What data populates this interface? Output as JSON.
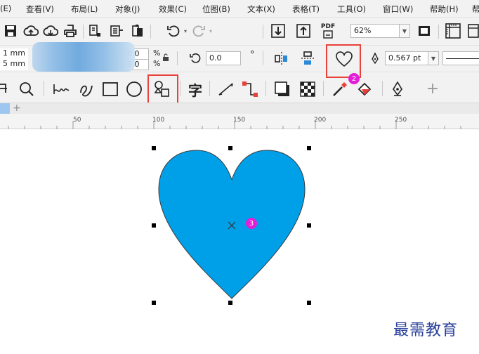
{
  "menu": [
    "(E)",
    "查看(V)",
    "布局(L)",
    "对象(J)",
    "效果(C)",
    "位图(B)",
    "文本(X)",
    "表格(T)",
    "工具(O)",
    "窗口(W)",
    "帮助(H)",
    "帮"
  ],
  "toolbar1": {
    "zoom_value": "62%",
    "pdf_label": "PDF"
  },
  "toolbar2": {
    "width_value": "1 mm",
    "height_value": "5 mm",
    "scale_x": "0.0",
    "scale_y": "0.0",
    "percent": "%",
    "rotation_value": "0.0",
    "degree_symbol": "°",
    "outline_width": "0.567 pt"
  },
  "toolbar3": {
    "text_tool_glyph": "字",
    "plus_glyph": "+"
  },
  "doc_tabs": {
    "add_label": "+"
  },
  "ruler": {
    "labels": [
      "50",
      "100",
      "150",
      "200",
      "250"
    ]
  },
  "badges": [
    "1",
    "2",
    "3"
  ],
  "shape": {
    "fill_color": "#00a0e9",
    "outline_color": "#3a3a3a"
  },
  "watermark": "最需教育"
}
